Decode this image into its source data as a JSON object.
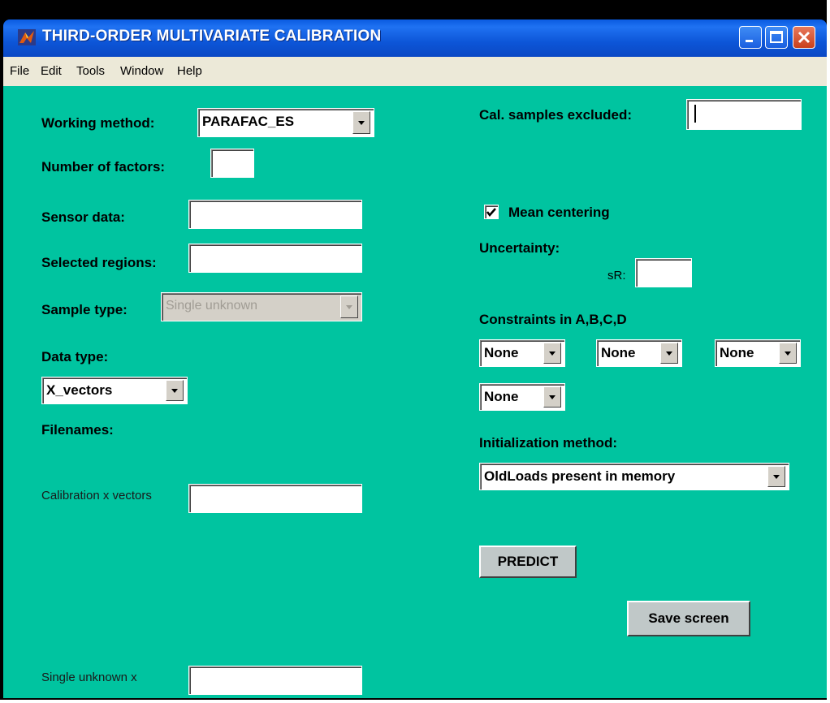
{
  "window": {
    "title": "THIRD-ORDER MULTIVARIATE CALIBRATION",
    "app_icon": "matlab-icon",
    "controls": [
      "minimize-icon",
      "maximize-icon",
      "close-icon"
    ]
  },
  "menu": {
    "items": [
      "File",
      "Edit",
      "Tools",
      "Window",
      "Help"
    ]
  },
  "left": {
    "working_method_label": "Working method:",
    "working_method_value": "PARAFAC_ES",
    "num_factors_label": "Number of factors:",
    "num_factors_value": "",
    "sensor_data_label": "Sensor data:",
    "sensor_data_value": "",
    "selected_regions_label": "Selected regions:",
    "selected_regions_value": "",
    "sample_type_label": "Sample type:",
    "sample_type_value": "Single unknown",
    "data_type_label": "Data type:",
    "data_type_value": "X_vectors",
    "filenames_label": "Filenames:",
    "calibration_label": "Calibration x vectors",
    "calibration_value": "",
    "single_unknown_label": "Single unknown x",
    "single_unknown_value": ""
  },
  "right": {
    "cal_excluded_label": "Cal. samples excluded:",
    "cal_excluded_value": "",
    "mean_centering_label": "Mean centering",
    "mean_centering_checked": true,
    "uncertainty_label": "Uncertainty:",
    "sr_label": "sR:",
    "sr_value": "",
    "constraints_label": "Constraints in A,B,C,D",
    "constraints": [
      "None",
      "None",
      "None",
      "None"
    ],
    "init_method_label": "Initialization method:",
    "init_method_value": "OldLoads present in memory",
    "predict_label": "PREDICT",
    "save_label": "Save screen"
  },
  "colors": {
    "background": "#00c4a0",
    "titlebar": "#0a5be0",
    "menubar": "#ece9d8",
    "button_face": "#c0c8c8"
  }
}
